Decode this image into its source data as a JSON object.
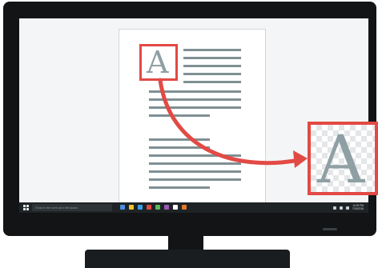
{
  "taskbar": {
    "search_placeholder": "Search the web and Windows",
    "clock_time": "10:29 PM",
    "clock_date": "7/15/2016"
  },
  "document": {
    "glyph": "A",
    "zoomed_glyph": "A"
  },
  "icons": {
    "start": "windows-start-icon",
    "arrow": "curved-arrow-icon"
  },
  "colors": {
    "accent": "#e24a45",
    "monitor": "#121416",
    "text_lines": "#7f9094",
    "glyph": "#8fa0a4",
    "taskbar": "#1e2326"
  },
  "task_icon_colors": [
    "#4c8ee8",
    "#f1c232",
    "#3aa0e6",
    "#e24a45",
    "#5cb85c",
    "#9b59b6",
    "#ffffff",
    "#e07a2a"
  ]
}
